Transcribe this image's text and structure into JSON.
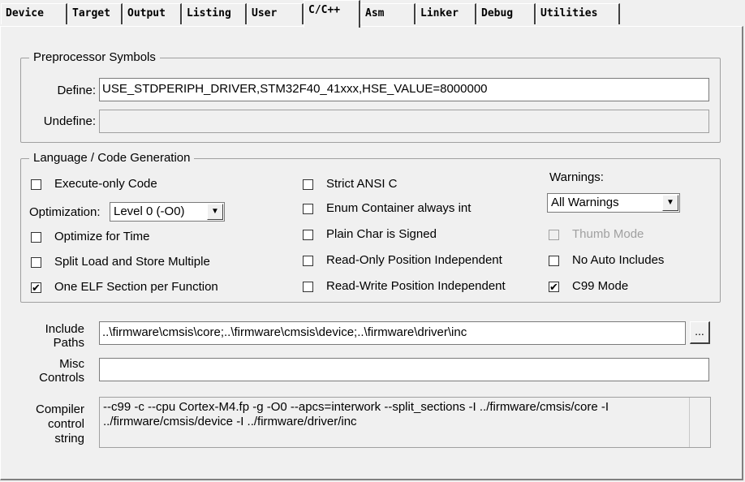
{
  "tabs": [
    {
      "label": "Device",
      "active": false
    },
    {
      "label": "Target",
      "active": false
    },
    {
      "label": "Output",
      "active": false
    },
    {
      "label": "Listing",
      "active": false
    },
    {
      "label": "User",
      "active": false
    },
    {
      "label": "C/C++",
      "active": true
    },
    {
      "label": "Asm",
      "active": false
    },
    {
      "label": "Linker",
      "active": false
    },
    {
      "label": "Debug",
      "active": false
    },
    {
      "label": "Utilities",
      "active": false
    }
  ],
  "preprocessor": {
    "title": "Preprocessor Symbols",
    "define_label": "Define:",
    "define_value": "USE_STDPERIPH_DRIVER,STM32F40_41xxx,HSE_VALUE=8000000",
    "undefine_label": "Undefine:",
    "undefine_value": ""
  },
  "language": {
    "title": "Language / Code Generation",
    "execute_only": {
      "label": "Execute-only Code",
      "checked": false
    },
    "optimization_label": "Optimization:",
    "optimization_value": "Level 0 (-O0)",
    "optimize_time": {
      "label": "Optimize for Time",
      "checked": false
    },
    "split_load": {
      "label": "Split Load and Store Multiple",
      "checked": false
    },
    "one_elf": {
      "label": "One ELF Section per Function",
      "checked": true
    },
    "strict_ansi": {
      "label": "Strict ANSI C",
      "checked": false
    },
    "enum_container": {
      "label": "Enum Container always int",
      "checked": false
    },
    "plain_char": {
      "label": "Plain Char is Signed",
      "checked": false
    },
    "ro_pi": {
      "label": "Read-Only Position Independent",
      "checked": false
    },
    "rw_pi": {
      "label": "Read-Write Position Independent",
      "checked": false
    },
    "warnings_label": "Warnings:",
    "warnings_value": "All Warnings",
    "thumb_mode": {
      "label": "Thumb Mode",
      "checked": false,
      "disabled": true
    },
    "no_auto_includes": {
      "label": "No Auto Includes",
      "checked": false
    },
    "c99_mode": {
      "label": "C99 Mode",
      "checked": true
    }
  },
  "include": {
    "label_line1": "Include",
    "label_line2": "Paths",
    "value": "..\\firmware\\cmsis\\core;..\\firmware\\cmsis\\device;..\\firmware\\driver\\inc",
    "browse_label": "..."
  },
  "misc": {
    "label_line1": "Misc",
    "label_line2": "Controls",
    "value": ""
  },
  "compiler": {
    "label_line1": "Compiler",
    "label_line2": "control",
    "label_line3": "string",
    "line1": "--c99 -c --cpu Cortex-M4.fp -g -O0 --apcs=interwork --split_sections -I ../firmware/cmsis/core -I",
    "line2": "../firmware/cmsis/device -I ../firmware/driver/inc"
  },
  "icons": {
    "check_glyph": "✔",
    "dropdown_glyph": "▼"
  }
}
